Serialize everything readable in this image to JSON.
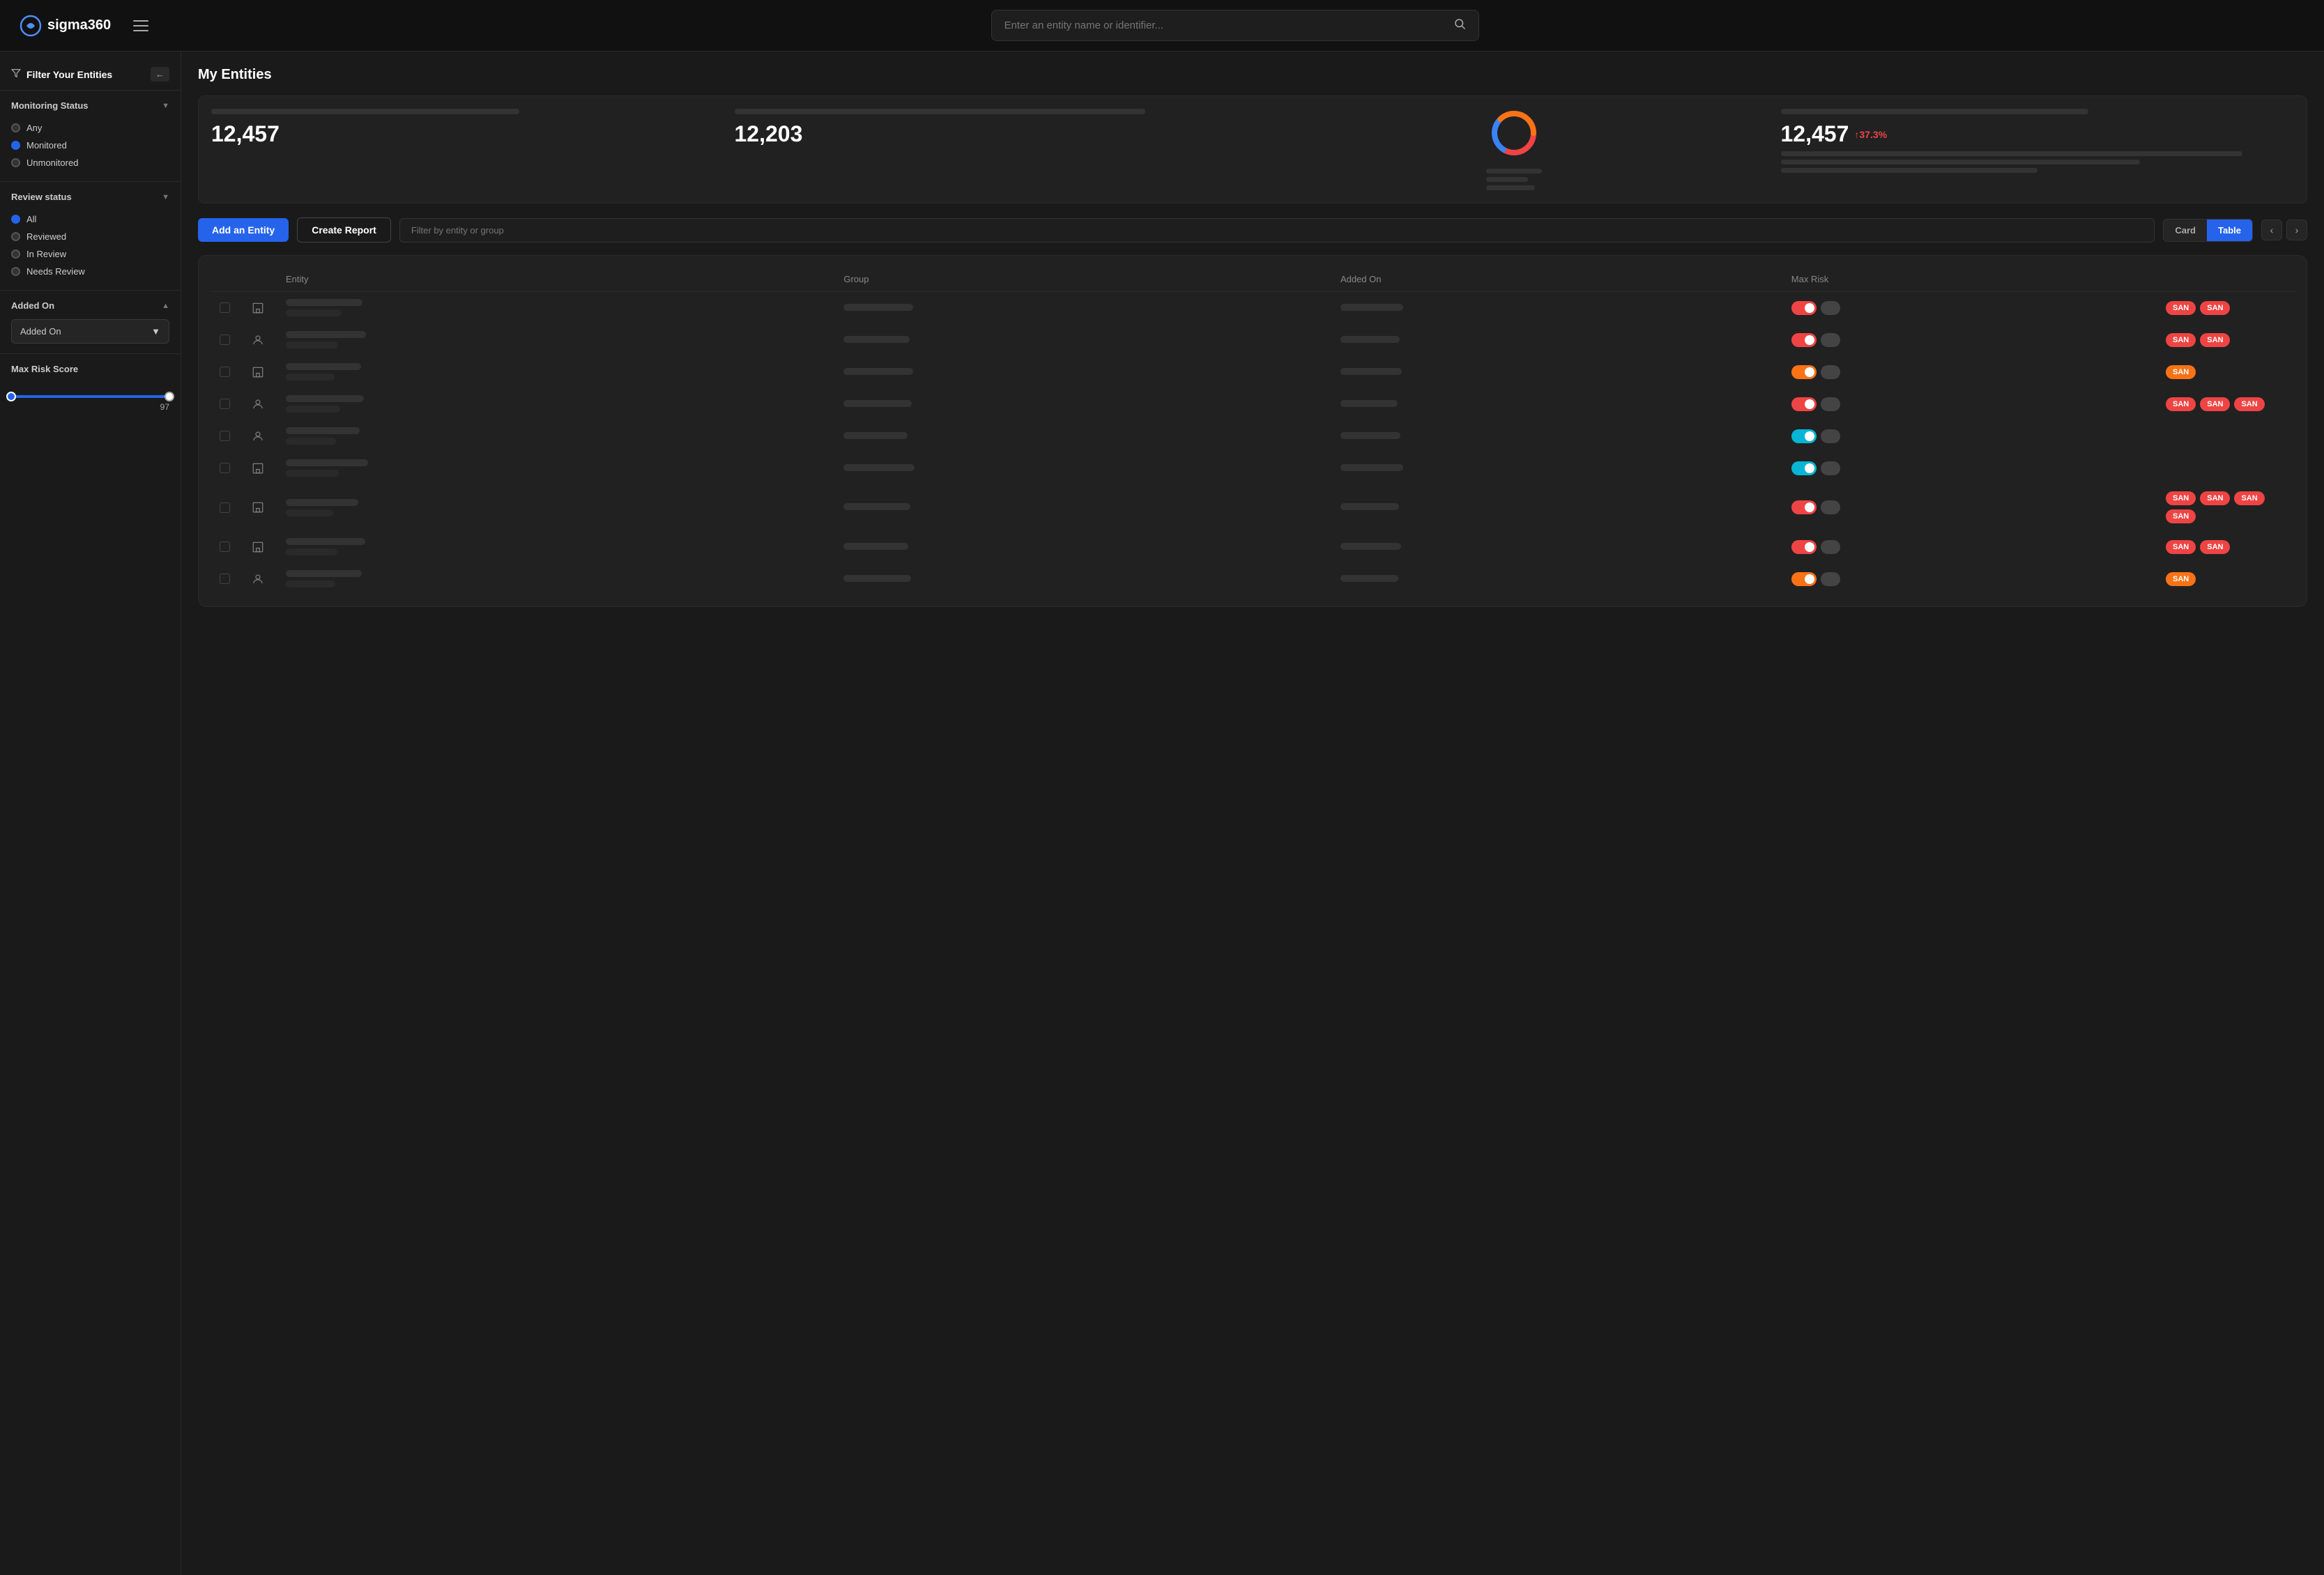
{
  "app": {
    "logo_text": "sigma360",
    "search_placeholder": "Enter an entity name or identifier..."
  },
  "sidebar": {
    "title": "Filter Your Entities",
    "sections": [
      {
        "id": "monitoring_status",
        "label": "Monitoring Status",
        "expanded": true,
        "options": [
          {
            "id": "any",
            "label": "Any",
            "active": false
          },
          {
            "id": "monitored",
            "label": "Monitored",
            "active": true
          },
          {
            "id": "unmonitored",
            "label": "Unmonitored",
            "active": false
          }
        ]
      },
      {
        "id": "review_status",
        "label": "Review status",
        "expanded": true,
        "options": [
          {
            "id": "all",
            "label": "All",
            "active": true
          },
          {
            "id": "reviewed",
            "label": "Reviewed",
            "active": false
          },
          {
            "id": "in_review",
            "label": "In Review",
            "active": false
          },
          {
            "id": "needs_review",
            "label": "Needs Review",
            "active": false
          }
        ]
      },
      {
        "id": "added_on",
        "label": "Added On",
        "expanded": true,
        "sub_label": "Added On"
      },
      {
        "id": "max_risk",
        "label": "Max Risk Score",
        "expanded": true,
        "slider_max": 97,
        "slider_label": "97"
      }
    ]
  },
  "main": {
    "page_title": "My Entities",
    "stats": [
      {
        "id": "stat1",
        "number": "12,457"
      },
      {
        "id": "stat2",
        "number": "12,203"
      },
      {
        "id": "stat3",
        "type": "donut"
      },
      {
        "id": "stat4",
        "number": "12,457",
        "badge": "↑37.3%"
      }
    ],
    "toolbar": {
      "add_label": "Add an Entity",
      "report_label": "Create Report",
      "filter_placeholder": "Filter by entity or group",
      "view_card": "Card",
      "view_table": "Table"
    },
    "table": {
      "columns": [
        "",
        "",
        "Entity",
        "Group",
        "Added On",
        "Max Risk",
        ""
      ],
      "rows": [
        {
          "type": "building",
          "toggle": "red",
          "badges": [
            "SAN",
            "SAN"
          ]
        },
        {
          "type": "person",
          "toggle": "red",
          "badges": [
            "SAN",
            "SAN"
          ]
        },
        {
          "type": "building",
          "toggle": "orange",
          "badges": [
            "SAN"
          ]
        },
        {
          "type": "person",
          "toggle": "red",
          "badges": [
            "SAN",
            "SAN",
            "SAN"
          ]
        },
        {
          "type": "person",
          "toggle": "blue",
          "badges": []
        },
        {
          "type": "building",
          "toggle": "blue",
          "badges": []
        },
        {
          "type": "building",
          "toggle": "red",
          "badges": [
            "SAN",
            "SAN",
            "SAN",
            "SAN"
          ]
        },
        {
          "type": "building",
          "toggle": "red",
          "badges": [
            "SAN",
            "SAN"
          ]
        },
        {
          "type": "person",
          "toggle": "orange",
          "badges": [
            "SAN"
          ]
        }
      ]
    }
  }
}
